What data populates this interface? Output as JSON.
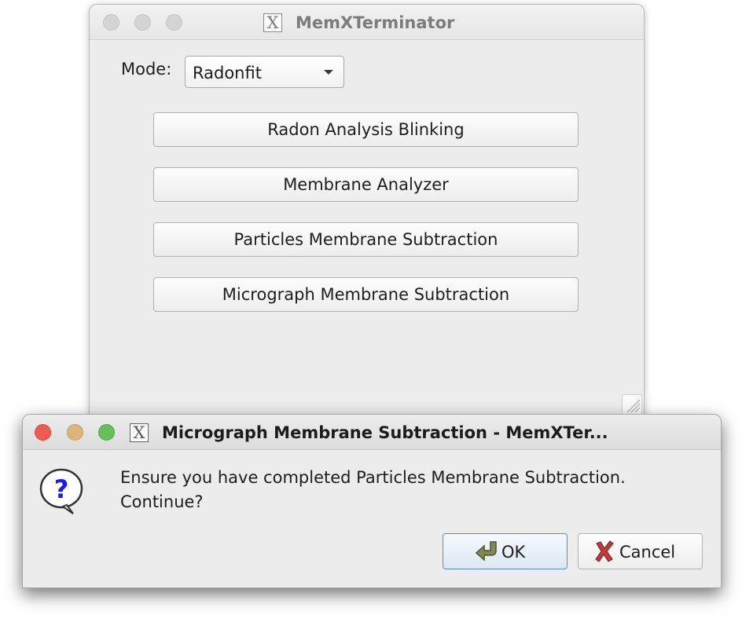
{
  "main_window": {
    "title": "MemXTerminator",
    "app_icon": "x-app-icon",
    "mode_label": "Mode:",
    "mode_value": "Radonfit",
    "buttons": [
      "Radon Analysis Blinking",
      "Membrane Analyzer",
      "Particles Membrane Subtraction",
      "Micrograph Membrane Subtraction"
    ]
  },
  "dialog": {
    "title": "Micrograph Membrane Subtraction - MemXTer...",
    "icon": "question-icon",
    "message_line1": "Ensure you have completed Particles Membrane Subtraction.",
    "message_line2": "Continue?",
    "ok_label": "OK",
    "cancel_label": "Cancel"
  },
  "colors": {
    "close": "#ee5b52",
    "minimize": "#dcb47e",
    "zoom": "#66c05a",
    "inactive_light": "#d4d4d4",
    "question_blue": "#1a1aff"
  }
}
